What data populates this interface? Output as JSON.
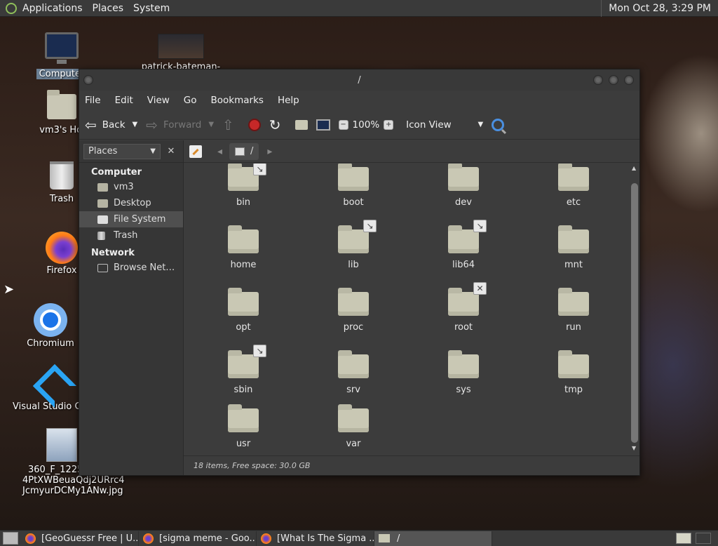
{
  "top_panel": {
    "menus": [
      "Applications",
      "Places",
      "System"
    ],
    "clock": "Mon Oct 28,  3:29 PM"
  },
  "desktop": {
    "icons": [
      {
        "label": "Computer",
        "icon": "computer-icon"
      },
      {
        "label": "patrick-bateman-",
        "icon": "image-thumbnail-icon"
      },
      {
        "label": "vm3's Hom",
        "icon": "home-folder-icon"
      },
      {
        "label": "Trash",
        "icon": "trash-icon"
      },
      {
        "label": "Firefox",
        "icon": "firefox-icon"
      },
      {
        "label": "Chromium",
        "icon": "chromium-icon"
      },
      {
        "label": "Visual Studio Co",
        "icon": "vscode-icon"
      },
      {
        "label_lines": [
          "360_F_1225",
          "4PtXWBeuaQdj2URrc4",
          "JcmyurDCMy1ANw.jpg"
        ],
        "icon": "image-file-icon"
      }
    ]
  },
  "window": {
    "title": "/",
    "menu": [
      "File",
      "Edit",
      "View",
      "Go",
      "Bookmarks",
      "Help"
    ],
    "toolbar": {
      "back": "Back",
      "forward": "Forward",
      "zoom": "100%",
      "view_mode": "Icon View"
    },
    "sidebar": {
      "selector": "Places",
      "sections": [
        {
          "heading": "Computer",
          "items": [
            "vm3",
            "Desktop",
            "File System",
            "Trash"
          ]
        },
        {
          "heading": "Network",
          "items": [
            "Browse Net…"
          ]
        }
      ],
      "active_item": "File System"
    },
    "pathbar": {
      "crumb": "/"
    },
    "files": [
      {
        "name": "bin",
        "emblem": "symlink"
      },
      {
        "name": "boot"
      },
      {
        "name": "dev"
      },
      {
        "name": "etc"
      },
      {
        "name": "home"
      },
      {
        "name": "lib",
        "emblem": "symlink"
      },
      {
        "name": "lib64",
        "emblem": "symlink"
      },
      {
        "name": "mnt"
      },
      {
        "name": "opt"
      },
      {
        "name": "proc"
      },
      {
        "name": "root",
        "emblem": "unreadable"
      },
      {
        "name": "run"
      },
      {
        "name": "sbin",
        "emblem": "symlink"
      },
      {
        "name": "srv"
      },
      {
        "name": "sys"
      },
      {
        "name": "tmp"
      },
      {
        "name": "usr"
      },
      {
        "name": "var"
      }
    ],
    "status": "18 items, Free space: 30.0 GB"
  },
  "taskbar": {
    "tasks": [
      {
        "label": "[GeoGuessr Free | U...",
        "icon": "firefox-icon"
      },
      {
        "label": "[sigma meme - Goo...",
        "icon": "firefox-icon"
      },
      {
        "label": "[What Is The Sigma ...",
        "icon": "firefox-icon"
      },
      {
        "label": "/",
        "icon": "folder-icon",
        "active": true
      }
    ]
  }
}
